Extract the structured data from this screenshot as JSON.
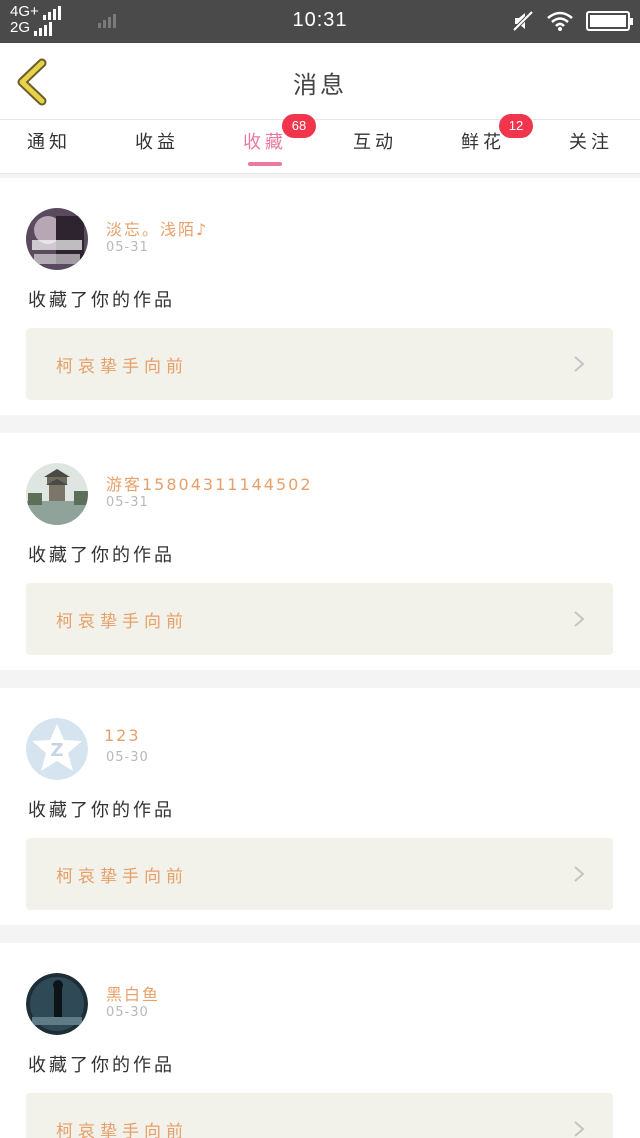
{
  "status_bar": {
    "network_top": "4G+",
    "network_bottom": "2G",
    "time": "10:31"
  },
  "header": {
    "title": "消息",
    "back_icon": "chevron-left-icon"
  },
  "tabs": [
    {
      "label": "通知",
      "badge": ""
    },
    {
      "label": "收益",
      "badge": ""
    },
    {
      "label": "收藏",
      "badge": "68",
      "active": true
    },
    {
      "label": "互动",
      "badge": ""
    },
    {
      "label": "鲜花",
      "badge": "12"
    },
    {
      "label": "关注",
      "badge": ""
    }
  ],
  "messages": [
    {
      "nickname": "淡忘。浅陌♪",
      "date": "05-31",
      "text": "收藏了你的作品",
      "work_title": "柯哀挚手向前"
    },
    {
      "nickname": "游客15804311144502",
      "date": "05-31",
      "text": "收藏了你的作品",
      "work_title": "柯哀挚手向前"
    },
    {
      "nickname": "123",
      "date": "05-30",
      "text": "收藏了你的作品",
      "work_title": "柯哀挚手向前"
    },
    {
      "nickname": "黑白鱼",
      "date": "05-30",
      "text": "收藏了你的作品",
      "work_title": "柯哀挚手向前"
    }
  ],
  "colors": {
    "accent_pink": "#e9799f",
    "badge_red": "#f0354c",
    "nickname_orange": "#e8a06a",
    "back_arrow_yellow": "#e8d24a"
  }
}
